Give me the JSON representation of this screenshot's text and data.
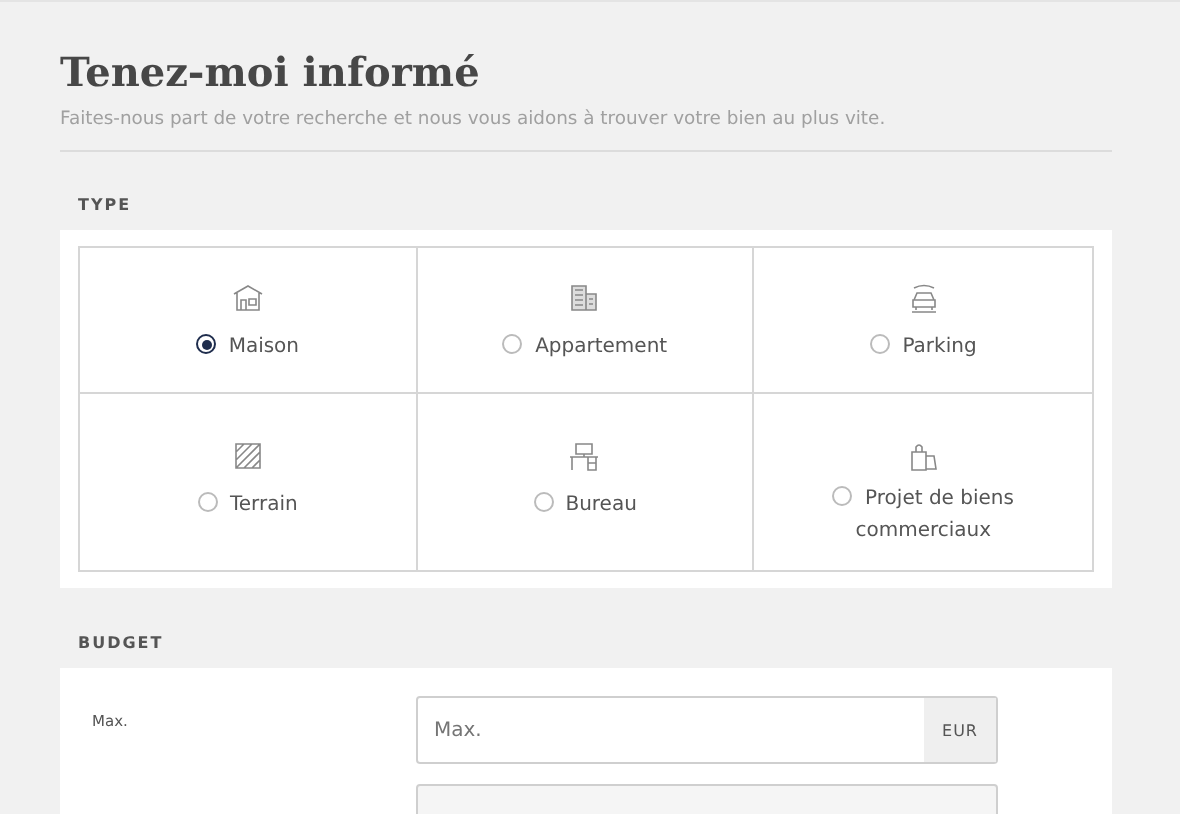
{
  "header": {
    "title": "Tenez-moi informé",
    "subtitle": "Faites-nous part de votre recherche et nous vous aidons à trouver votre bien au plus vite."
  },
  "type_section": {
    "heading": "TYPE",
    "options": [
      {
        "label": "Maison",
        "selected": true
      },
      {
        "label": "Appartement",
        "selected": false
      },
      {
        "label": "Parking",
        "selected": false
      },
      {
        "label": "Terrain",
        "selected": false
      },
      {
        "label": "Bureau",
        "selected": false
      },
      {
        "label": "Projet de biens commerciaux",
        "selected": false
      }
    ]
  },
  "budget_section": {
    "heading": "BUDGET",
    "fields": [
      {
        "label": "Max.",
        "placeholder": "Max.",
        "unit": "EUR"
      }
    ]
  }
}
